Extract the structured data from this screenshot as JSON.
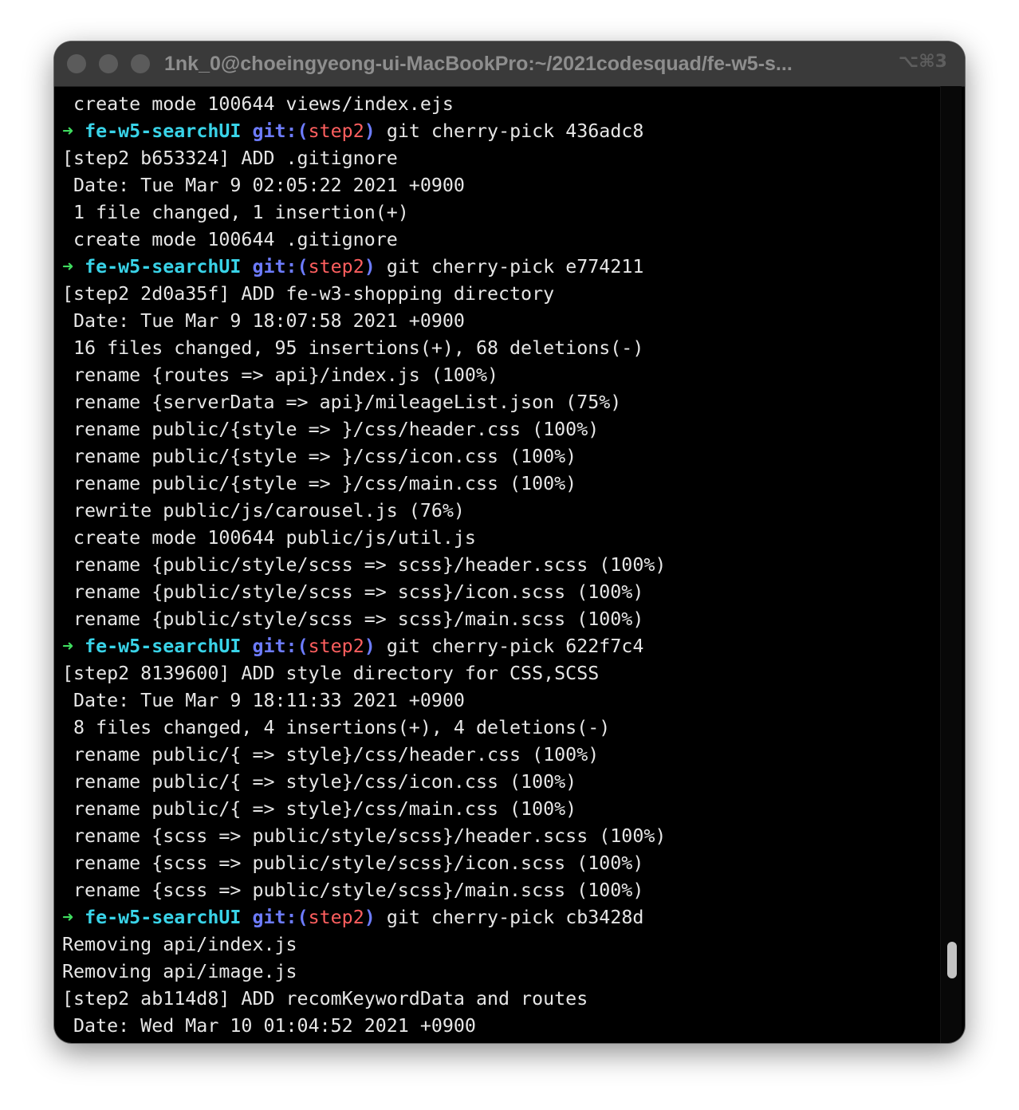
{
  "window": {
    "title": "1nk_0@choeingyeong-ui-MacBookPro:~/2021codesquad/fe-w5-s...",
    "shortcut": "⌥⌘3"
  },
  "colors": {
    "prompt_arrow": "#3fdc5f",
    "prompt_dir": "#39d3e8",
    "prompt_git": "#6d7cff",
    "prompt_branch": "#ff5f5f",
    "text": "#e6e6e6",
    "background": "#000000"
  },
  "icons": {
    "close": "traffic-light-close",
    "minimize": "traffic-light-minimize",
    "zoom": "traffic-light-zoom"
  },
  "terminal": {
    "lines": [
      {
        "type": "output",
        "text": " create mode 100644 views/index.ejs"
      },
      {
        "type": "prompt",
        "arrow": "➜",
        "dir": "fe-w5-searchUI",
        "git": "git:(",
        "branch": "step2",
        "git_close": ")",
        "command": "git cherry-pick 436adc8"
      },
      {
        "type": "output",
        "text": "[step2 b653324] ADD .gitignore"
      },
      {
        "type": "output",
        "text": " Date: Tue Mar 9 02:05:22 2021 +0900"
      },
      {
        "type": "output",
        "text": " 1 file changed, 1 insertion(+)"
      },
      {
        "type": "output",
        "text": " create mode 100644 .gitignore"
      },
      {
        "type": "prompt",
        "arrow": "➜",
        "dir": "fe-w5-searchUI",
        "git": "git:(",
        "branch": "step2",
        "git_close": ")",
        "command": "git cherry-pick e774211"
      },
      {
        "type": "output",
        "text": "[step2 2d0a35f] ADD fe-w3-shopping directory"
      },
      {
        "type": "output",
        "text": " Date: Tue Mar 9 18:07:58 2021 +0900"
      },
      {
        "type": "output",
        "text": " 16 files changed, 95 insertions(+), 68 deletions(-)"
      },
      {
        "type": "output",
        "text": " rename {routes => api}/index.js (100%)"
      },
      {
        "type": "output",
        "text": " rename {serverData => api}/mileageList.json (75%)"
      },
      {
        "type": "output",
        "text": " rename public/{style => }/css/header.css (100%)"
      },
      {
        "type": "output",
        "text": " rename public/{style => }/css/icon.css (100%)"
      },
      {
        "type": "output",
        "text": " rename public/{style => }/css/main.css (100%)"
      },
      {
        "type": "output",
        "text": " rewrite public/js/carousel.js (76%)"
      },
      {
        "type": "output",
        "text": " create mode 100644 public/js/util.js"
      },
      {
        "type": "output",
        "text": " rename {public/style/scss => scss}/header.scss (100%)"
      },
      {
        "type": "output",
        "text": " rename {public/style/scss => scss}/icon.scss (100%)"
      },
      {
        "type": "output",
        "text": " rename {public/style/scss => scss}/main.scss (100%)"
      },
      {
        "type": "prompt",
        "arrow": "➜",
        "dir": "fe-w5-searchUI",
        "git": "git:(",
        "branch": "step2",
        "git_close": ")",
        "command": "git cherry-pick 622f7c4"
      },
      {
        "type": "output",
        "text": "[step2 8139600] ADD style directory for CSS,SCSS"
      },
      {
        "type": "output",
        "text": " Date: Tue Mar 9 18:11:33 2021 +0900"
      },
      {
        "type": "output",
        "text": " 8 files changed, 4 insertions(+), 4 deletions(-)"
      },
      {
        "type": "output",
        "text": " rename public/{ => style}/css/header.css (100%)"
      },
      {
        "type": "output",
        "text": " rename public/{ => style}/css/icon.css (100%)"
      },
      {
        "type": "output",
        "text": " rename public/{ => style}/css/main.css (100%)"
      },
      {
        "type": "output",
        "text": " rename {scss => public/style/scss}/header.scss (100%)"
      },
      {
        "type": "output",
        "text": " rename {scss => public/style/scss}/icon.scss (100%)"
      },
      {
        "type": "output",
        "text": " rename {scss => public/style/scss}/main.scss (100%)"
      },
      {
        "type": "prompt",
        "arrow": "➜",
        "dir": "fe-w5-searchUI",
        "git": "git:(",
        "branch": "step2",
        "git_close": ")",
        "command": "git cherry-pick cb3428d"
      },
      {
        "type": "output",
        "text": "Removing api/index.js"
      },
      {
        "type": "output",
        "text": "Removing api/image.js"
      },
      {
        "type": "output",
        "text": "[step2 ab114d8] ADD recomKeywordData and routes"
      },
      {
        "type": "output",
        "text": " Date: Wed Mar 10 01:04:52 2021 +0900"
      }
    ]
  },
  "scrollbar": {
    "position_fraction": 0.93
  }
}
